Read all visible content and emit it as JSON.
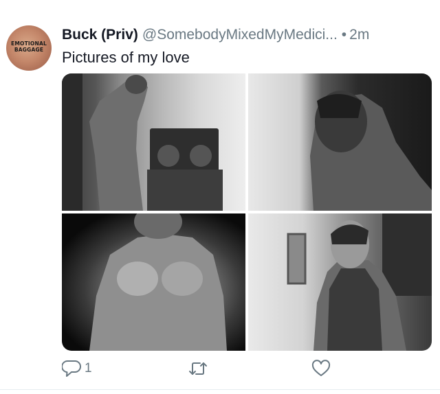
{
  "tweet": {
    "avatar_text": [
      "EMOTIONAL",
      "BAGGAGE"
    ],
    "author_name": "Buck (Priv)",
    "author_handle": "@SomebodyMixedMyMedici...",
    "separator": "•",
    "timestamp": "2m",
    "text": "Pictures of my love",
    "photos": [
      {
        "description": "shirtless man leaning against a wall next to a boombox"
      },
      {
        "description": "man with head bowed, hand on his neck"
      },
      {
        "description": "shirtless man's torso in dark lighting"
      },
      {
        "description": "man in a striped tank top looking out a window"
      }
    ],
    "actions": {
      "reply_count": "1",
      "retweet_count": "",
      "like_count": ""
    }
  },
  "colors": {
    "text_primary": "#141823",
    "text_secondary": "#697882",
    "avatar": "#c4876a"
  }
}
